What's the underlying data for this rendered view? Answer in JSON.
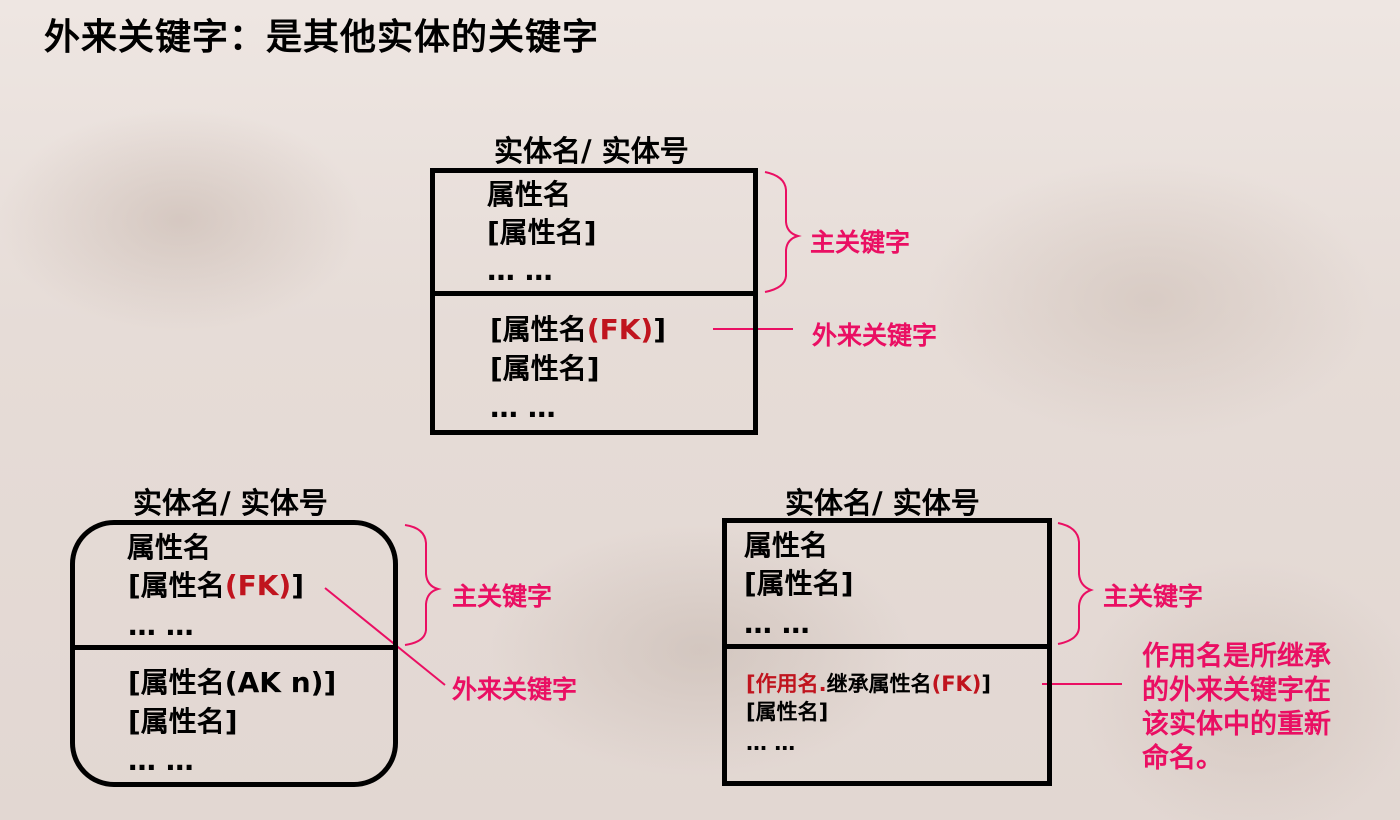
{
  "title": "外来关键字：是其他实体的关键字",
  "top_entity": {
    "header": "实体名/ 实体号",
    "pk_rows": [
      "属性名",
      "[属性名]",
      "… …"
    ],
    "fk_row": {
      "prefix": "[属性名",
      "fk": "(FK)",
      "suffix": "]"
    },
    "nonkey_rows": [
      "[属性名]",
      "… …"
    ],
    "pk_label": "主关键字",
    "fk_label": "外来关键字"
  },
  "left_entity": {
    "header": "实体名/ 实体号",
    "pk_row1": "属性名",
    "pk_fk_row": {
      "prefix": "[属性名",
      "fk": "(FK)",
      "suffix": "]"
    },
    "pk_row3": "… …",
    "nonkey_rows": [
      "[属性名(AK n)]",
      "[属性名]",
      "… …"
    ],
    "pk_label": "主关键字",
    "fk_label": "外来关键字"
  },
  "right_entity": {
    "header": "实体名/ 实体号",
    "pk_rows": [
      "属性名",
      "[属性名]",
      "… …"
    ],
    "role_row": {
      "open": "[",
      "role": "作用名.",
      "inherited": "继承属性名",
      "fk": "(FK)",
      "close": "]"
    },
    "nonkey_rows": [
      "[属性名]",
      "… …"
    ],
    "pk_label": "主关键字",
    "role_note": [
      "作用名是所继承",
      "的外来关键字在",
      "该实体中的重新",
      "命名。"
    ]
  },
  "colors": {
    "accent": "#ea0f63",
    "fk": "#c0141e",
    "line": "#000000"
  }
}
